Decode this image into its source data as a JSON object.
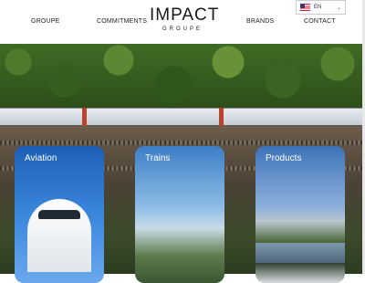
{
  "header": {
    "nav_left": [
      "GROUPE",
      "COMMITMENTS"
    ],
    "nav_right": [
      "BRANDS",
      "CONTACT"
    ],
    "logo": {
      "main": "IMPACT",
      "sub": "GROUPE"
    },
    "language": {
      "code": "EN",
      "flag_icon": "us-flag-icon"
    }
  },
  "cards": [
    {
      "title": "Aviation"
    },
    {
      "title": "Trains"
    },
    {
      "title": "Products"
    }
  ],
  "colors": {
    "accent_blue": "#1d5fb8",
    "logo_text": "#1a1a1a"
  }
}
